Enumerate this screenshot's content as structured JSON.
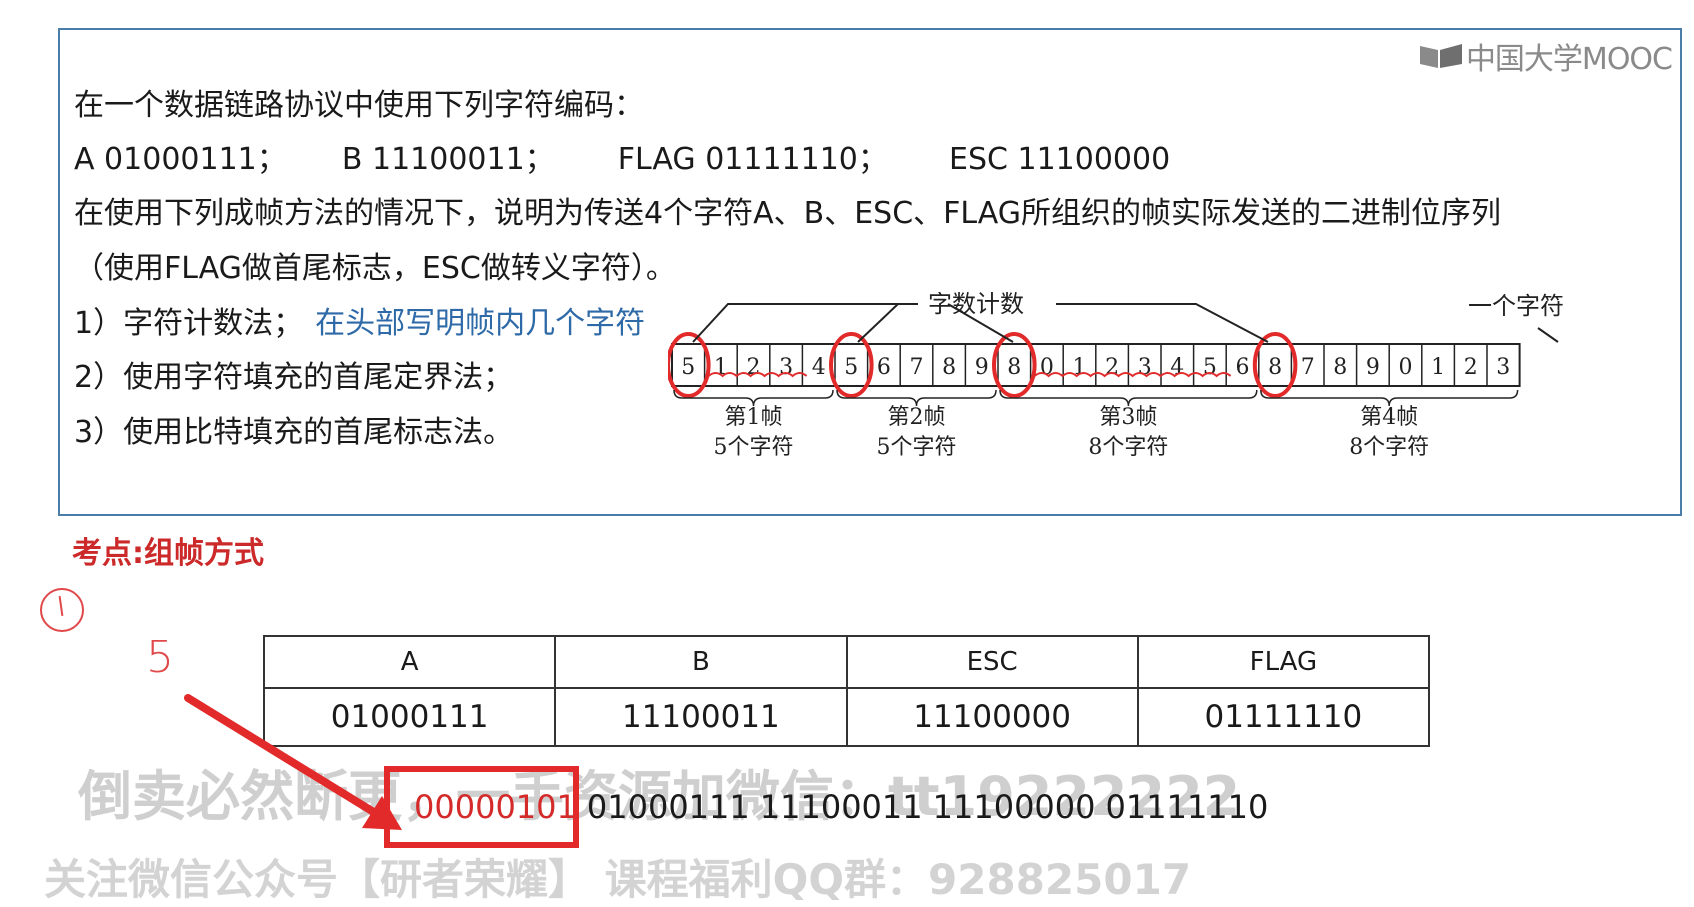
{
  "logo": {
    "text": "中国大学MOOC"
  },
  "question": {
    "line1": "在一个数据链路协议中使用下列字符编码：",
    "codes": [
      "A 01000111；",
      "B 11100011；",
      "FLAG 01111110；",
      "ESC 11100000"
    ],
    "line3": "在使用下列成帧方法的情况下，说明为传送4个字符A、B、ESC、FLAG所组织的帧实际发送的二进制位序列",
    "line4": "（使用FLAG做首尾标志，ESC做转义字符）。",
    "items": [
      {
        "text": "1）字符计数法；",
        "note": "在头部写明帧内几个字符"
      },
      {
        "text": "2）使用字符填充的首尾定界法；"
      },
      {
        "text": "3）使用比特填充的首尾标志法。"
      }
    ]
  },
  "diagram": {
    "top_label": "字数计数",
    "right_label": "一个字符",
    "cells": [
      "5",
      "1",
      "2",
      "3",
      "4",
      "5",
      "6",
      "7",
      "8",
      "9",
      "8",
      "0",
      "1",
      "2",
      "3",
      "4",
      "5",
      "6",
      "8",
      "7",
      "8",
      "9",
      "0",
      "1",
      "2",
      "3"
    ],
    "frames": [
      {
        "name": "第1帧",
        "count": "5个字符"
      },
      {
        "name": "第2帧",
        "count": "5个字符"
      },
      {
        "name": "第3帧",
        "count": "8个字符"
      },
      {
        "name": "第4帧",
        "count": "8个字符"
      }
    ]
  },
  "kaodian": "考点:组帧方式",
  "handwriting": {
    "five": "5"
  },
  "table": {
    "headers": [
      "A",
      "B",
      "ESC",
      "FLAG"
    ],
    "values": [
      "01000111",
      "11100011",
      "11100000",
      "01111110"
    ]
  },
  "answer_bits": {
    "count_field": "00000101",
    "rest": [
      "01000111",
      "11100011",
      "11100000",
      "01111110"
    ]
  },
  "watermarks": {
    "line1": "倒卖必然断更，一手资源加微信：tt19222222",
    "line2": "关注微信公众号【研者荣耀】 课程福利QQ群：928825017"
  },
  "colors": {
    "frame_border": "#4a7ea8",
    "blue_note": "#2f6aa8",
    "red": "#e22a2a"
  }
}
